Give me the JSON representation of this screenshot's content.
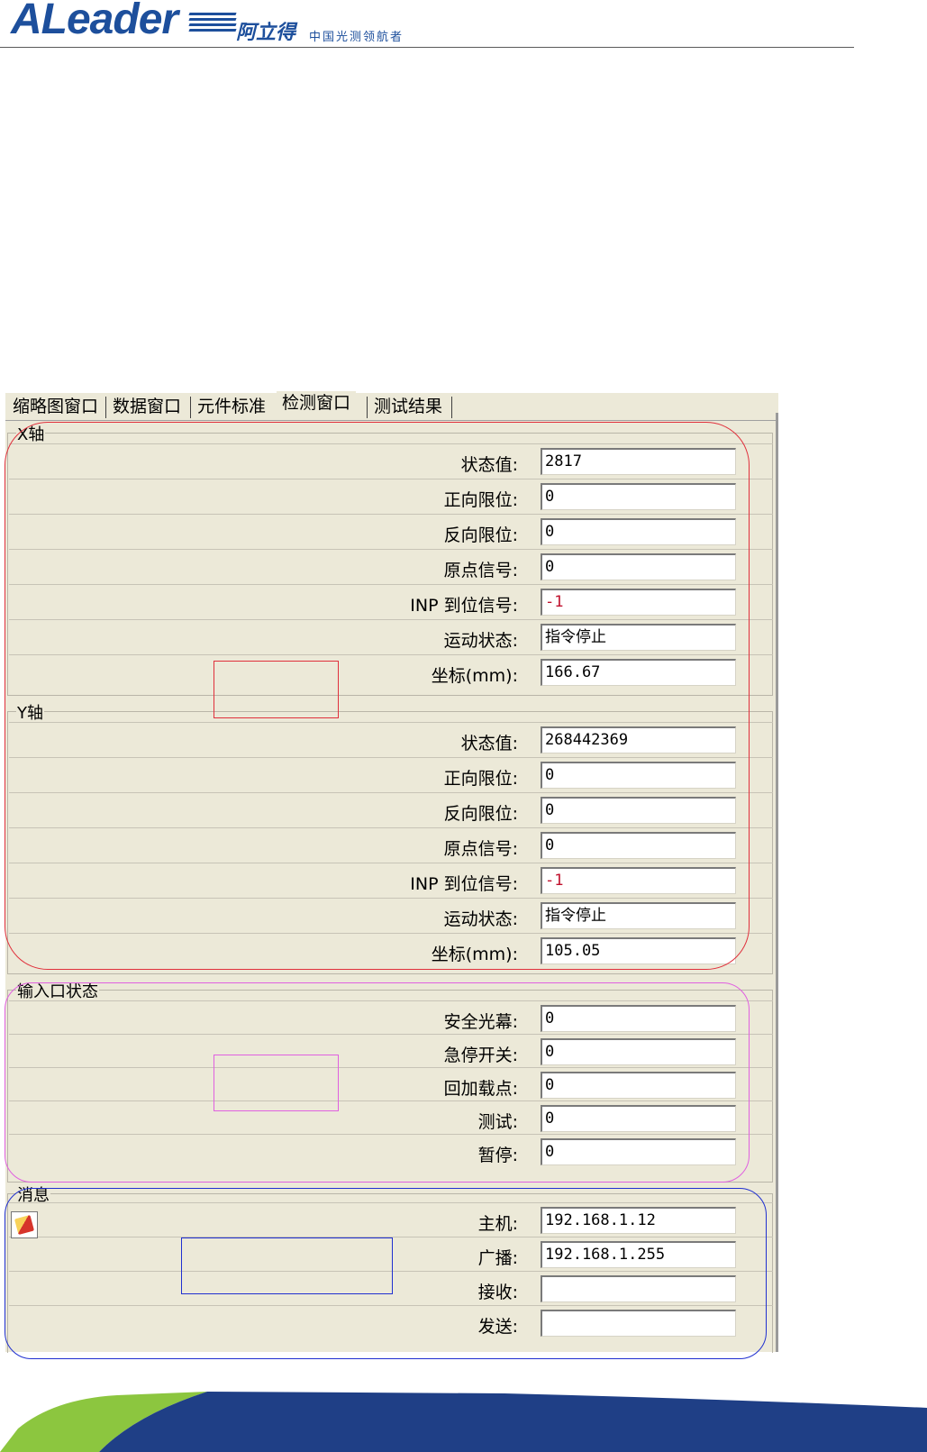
{
  "header": {
    "brand_latin": "ALeader",
    "brand_cn": "阿立得",
    "slogan": "中国光测领航者"
  },
  "tabs": [
    {
      "label": "缩略图窗口",
      "active": false
    },
    {
      "label": "数据窗口",
      "active": false
    },
    {
      "label": "元件标准",
      "active": false
    },
    {
      "label": "检测窗口",
      "active": true
    },
    {
      "label": "测试结果",
      "active": false
    }
  ],
  "x_axis": {
    "title": "X轴",
    "rows": [
      {
        "label": "状态值:",
        "value": "2817"
      },
      {
        "label": "正向限位:",
        "value": "0"
      },
      {
        "label": "反向限位:",
        "value": "0"
      },
      {
        "label": "原点信号:",
        "value": "0"
      },
      {
        "label": "INP 到位信号:",
        "value": "-1"
      },
      {
        "label": "运动状态:",
        "value": "指令停止"
      },
      {
        "label": "坐标(mm):",
        "value": "166.67"
      }
    ]
  },
  "y_axis": {
    "title": "Y轴",
    "rows": [
      {
        "label": "状态值:",
        "value": "268442369"
      },
      {
        "label": "正向限位:",
        "value": "0"
      },
      {
        "label": "反向限位:",
        "value": "0"
      },
      {
        "label": "原点信号:",
        "value": "0"
      },
      {
        "label": "INP 到位信号:",
        "value": "-1"
      },
      {
        "label": "运动状态:",
        "value": "指令停止"
      },
      {
        "label": "坐标(mm):",
        "value": "105.05"
      }
    ]
  },
  "input_status": {
    "title": "输入口状态",
    "rows": [
      {
        "label": "安全光幕:",
        "value": "0"
      },
      {
        "label": "急停开关:",
        "value": "0"
      },
      {
        "label": "回加载点:",
        "value": "0"
      },
      {
        "label": "测试:",
        "value": "0"
      },
      {
        "label": "暂停:",
        "value": "0"
      }
    ]
  },
  "message": {
    "title": "消息",
    "icon": "edit-message-icon",
    "rows": [
      {
        "label": "主机:",
        "value": "192.168.1.12"
      },
      {
        "label": "广播:",
        "value": "192.168.1.255"
      },
      {
        "label": "接收:",
        "value": ""
      },
      {
        "label": "发送:",
        "value": ""
      }
    ]
  },
  "colors": {
    "brand_blue": "#1d4f9c",
    "window_bg": "#ece9d8",
    "annotation_red": "#e0303c",
    "annotation_magenta": "#e060e0",
    "annotation_blue": "#2030d0",
    "negative_value": "#c0102c",
    "footer_green": "#8cc63f",
    "footer_navy": "#1f3f86"
  }
}
